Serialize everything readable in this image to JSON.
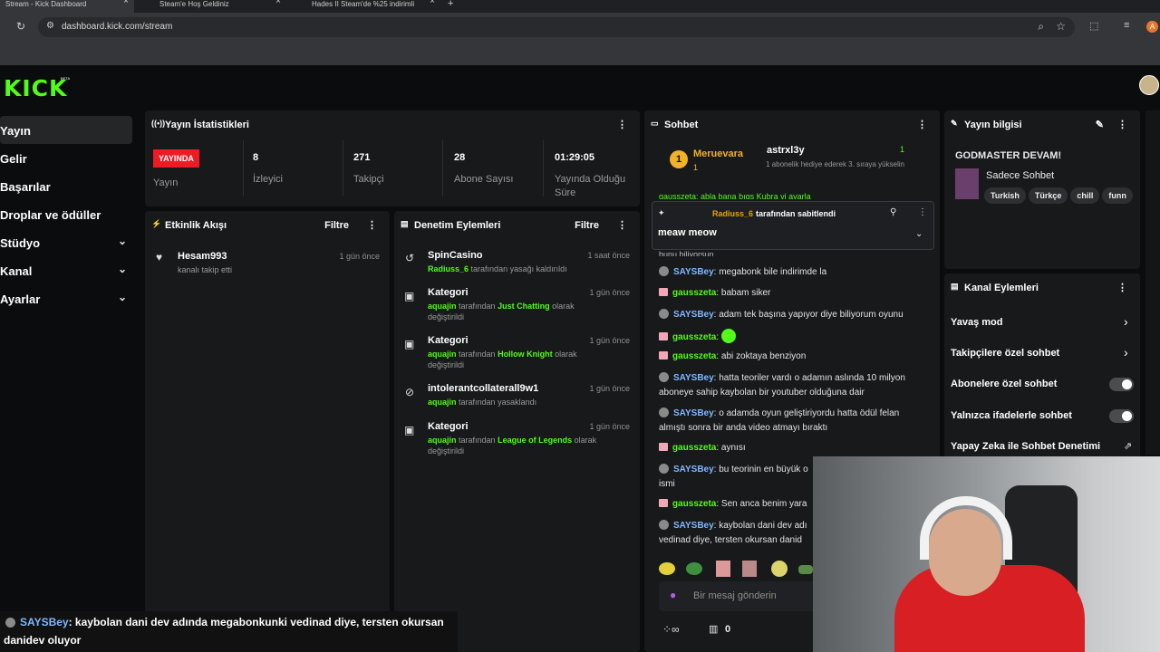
{
  "browser": {
    "tabs": [
      {
        "label": "Stream - Kick Dashboard",
        "active": true
      },
      {
        "label": "Steam'e Hoş Geldiniz",
        "active": false
      },
      {
        "label": "Hades II Steam'de %25 indirimli",
        "active": false
      }
    ],
    "url": "dashboard.kick.com/stream",
    "profile_initial": "A"
  },
  "brand": {
    "logo": "KICK",
    "beta": "BETA",
    "accent": "#53fc18"
  },
  "sidebar": {
    "items": [
      {
        "label": "Yayın"
      },
      {
        "label": "Gelir"
      },
      {
        "label": "Başarılar"
      },
      {
        "label": "Droplar ve ödüller"
      },
      {
        "label": "Stüdyo",
        "chevron": "⌄"
      },
      {
        "label": "Kanal",
        "chevron": "⌄"
      },
      {
        "label": "Ayarlar",
        "chevron": "⌄"
      }
    ]
  },
  "stats": {
    "title": "Yayın İstatistikleri",
    "live_badge": "YAYINDA",
    "live_label": "Yayın",
    "items": [
      {
        "value": "8",
        "label": "İzleyici"
      },
      {
        "value": "271",
        "label": "Takipçi"
      },
      {
        "value": "28",
        "label": "Abone Sayısı"
      },
      {
        "value": "01:29:05",
        "label": "Yayında Olduğu Süre"
      }
    ]
  },
  "activity": {
    "title": "Etkinlik Akışı",
    "filter": "Filtre",
    "events": [
      {
        "name": "Hesam993",
        "desc": "kanalı takip etti",
        "time": "1 gün önce"
      }
    ]
  },
  "moderation": {
    "title": "Denetim Eylemleri",
    "filter": "Filtre",
    "events": [
      {
        "name": "SpinCasino",
        "user": "Radiuss_6",
        "desc": "tarafından yasağı kaldırıldı",
        "time": "1 saat önce"
      },
      {
        "name": "Kategori",
        "user": "aquajin",
        "pre": "tarafından",
        "cat": "Just Chatting",
        "post": "olarak değiştirildi",
        "time": "1 gün önce"
      },
      {
        "name": "Kategori",
        "user": "aquajin",
        "pre": "tarafından",
        "cat": "Hollow Knight",
        "post": "olarak değiştirildi",
        "time": "1 gün önce"
      },
      {
        "name": "intolerantcollaterall9w1",
        "user": "aquajin",
        "desc": "tarafından yasaklandı",
        "time": "1 gün önce"
      },
      {
        "name": "Kategori",
        "user": "aquajin",
        "pre": "tarafından",
        "cat": "League of Legends",
        "post": "olarak değiştirildi",
        "time": "1 gün önce"
      }
    ]
  },
  "chat": {
    "title": "Sohbet",
    "top_gifter": {
      "rank": "1",
      "name": "Meruevara",
      "count": "1"
    },
    "second": {
      "name": "astrxl3y",
      "count": "1",
      "note": "1 abonelik hediye ederek 3. sıraya yükselin"
    },
    "pinned": {
      "by": "Radiuss_6",
      "by_text": "tarafından sabitlendi",
      "text": "meaw meow"
    },
    "partial_top": "gausszeta: abla bana bıqs Kubra yi ayarla",
    "partial_line": "bunu biliyorsun",
    "messages": [
      {
        "user": "SAYSBey",
        "text": ": megabonk bile indirimde la"
      },
      {
        "user": "gausszeta",
        "text": ": babam siker"
      },
      {
        "user": "SAYSBey",
        "text": ": adam tek başına yapıyor diye biliyorum oyunu"
      },
      {
        "user": "gausszeta",
        "text": ": "
      },
      {
        "user": "gausszeta",
        "text": ": abi zoktaya benziyon"
      },
      {
        "user": "SAYSBey",
        "text": ": hatta teoriler vardı o adamın aslında 10 milyon aboneye sahip kaybolan bir youtuber olduğuna dair"
      },
      {
        "user": "SAYSBey",
        "text": ": o adamda oyun geliştiriyordu hatta ödül felan almıştı sonra bir anda video atmayı bıraktı"
      },
      {
        "user": "gausszeta",
        "text": ": aynısı"
      },
      {
        "user": "SAYSBey",
        "text": ": bu teorinin en büyük o ismi"
      },
      {
        "user": "gausszeta",
        "text": ": Sen anca benim yara"
      },
      {
        "user": "SAYSBey",
        "text": ": kaybolan dani dev adı vedinad diye, tersten okursan danid"
      }
    ],
    "placeholder": "Bir mesaj gönderin",
    "points": "0",
    "saysbey_color": "#7fb8ff",
    "gauss_color": "#53fc18"
  },
  "info": {
    "title": "Yayın bilgisi",
    "stream_title": "GODMASTER DEVAM!",
    "category": "Sadece Sohbet",
    "tags": [
      "Turkish",
      "Türkçe",
      "chill",
      "funn"
    ]
  },
  "channel": {
    "title": "Kanal Eylemleri",
    "actions": [
      {
        "label": "Yavaş mod",
        "type": "arrow"
      },
      {
        "label": "Takipçilere özel sohbet",
        "type": "arrow"
      },
      {
        "label": "Abonelere özel sohbet",
        "type": "toggle"
      },
      {
        "label": "Yalnızca ifadelerle sohbet",
        "type": "toggle"
      },
      {
        "label": "Yapay Zeka ile Sohbet Denetimi",
        "type": "external"
      }
    ]
  },
  "caption": {
    "user": "SAYSBey",
    "text": ": kaybolan dani dev adında megabonkunki vedinad diye, tersten okursan danidev oluyor"
  }
}
